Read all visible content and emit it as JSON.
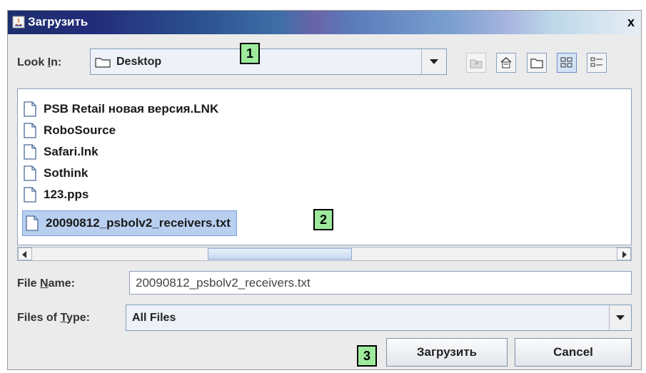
{
  "window": {
    "title": "Загрузить",
    "close_symbol": "x"
  },
  "lookin": {
    "label_pre": "Look ",
    "label_mnemonic": "I",
    "label_post": "n:",
    "value": "Desktop"
  },
  "toolbar": {
    "icons": [
      "up-folder-icon",
      "home-icon",
      "new-folder-icon",
      "list-view-icon",
      "details-view-icon"
    ]
  },
  "files": [
    {
      "name": "PSB Retail новая версия.LNK"
    },
    {
      "name": "RoboSource"
    },
    {
      "name": "Safari.lnk"
    },
    {
      "name": "Sothink"
    },
    {
      "name": "123.pps"
    },
    {
      "name": "20090812_psbolv2_receivers.txt",
      "selected": true
    }
  ],
  "filename": {
    "label_pre": "File ",
    "label_mnemonic": "N",
    "label_post": "ame:",
    "value": "20090812_psbolv2_receivers.txt"
  },
  "filetype": {
    "label_pre": "Files of ",
    "label_mnemonic": "T",
    "label_post": "ype:",
    "value": "All Files"
  },
  "buttons": {
    "open": "Загрузить",
    "cancel": "Cancel"
  },
  "markers": [
    "1",
    "2",
    "3"
  ],
  "colors": {
    "marker_bg": "#9dea9d",
    "selection_bg": "#b8cff0"
  }
}
